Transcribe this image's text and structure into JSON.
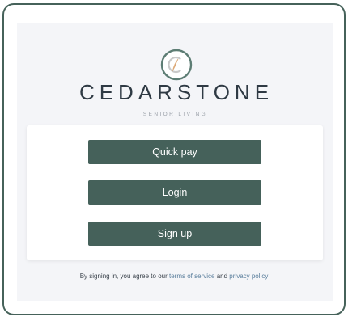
{
  "brand": {
    "name": "CEDARSTONE",
    "tagline": "SENIOR LIVING",
    "logo_icon": "feather-circle-logo-icon"
  },
  "actions": {
    "quick_pay_label": "Quick pay",
    "login_label": "Login",
    "signup_label": "Sign up"
  },
  "legal": {
    "prefix": "By signing in, you agree to our",
    "terms_label": "terms of service",
    "and_text": "and",
    "privacy_label": "privacy policy"
  },
  "colors": {
    "accent": "#45615a",
    "frame_border": "#46625a",
    "background": "#f4f5f8",
    "link": "#5a7e9c"
  }
}
